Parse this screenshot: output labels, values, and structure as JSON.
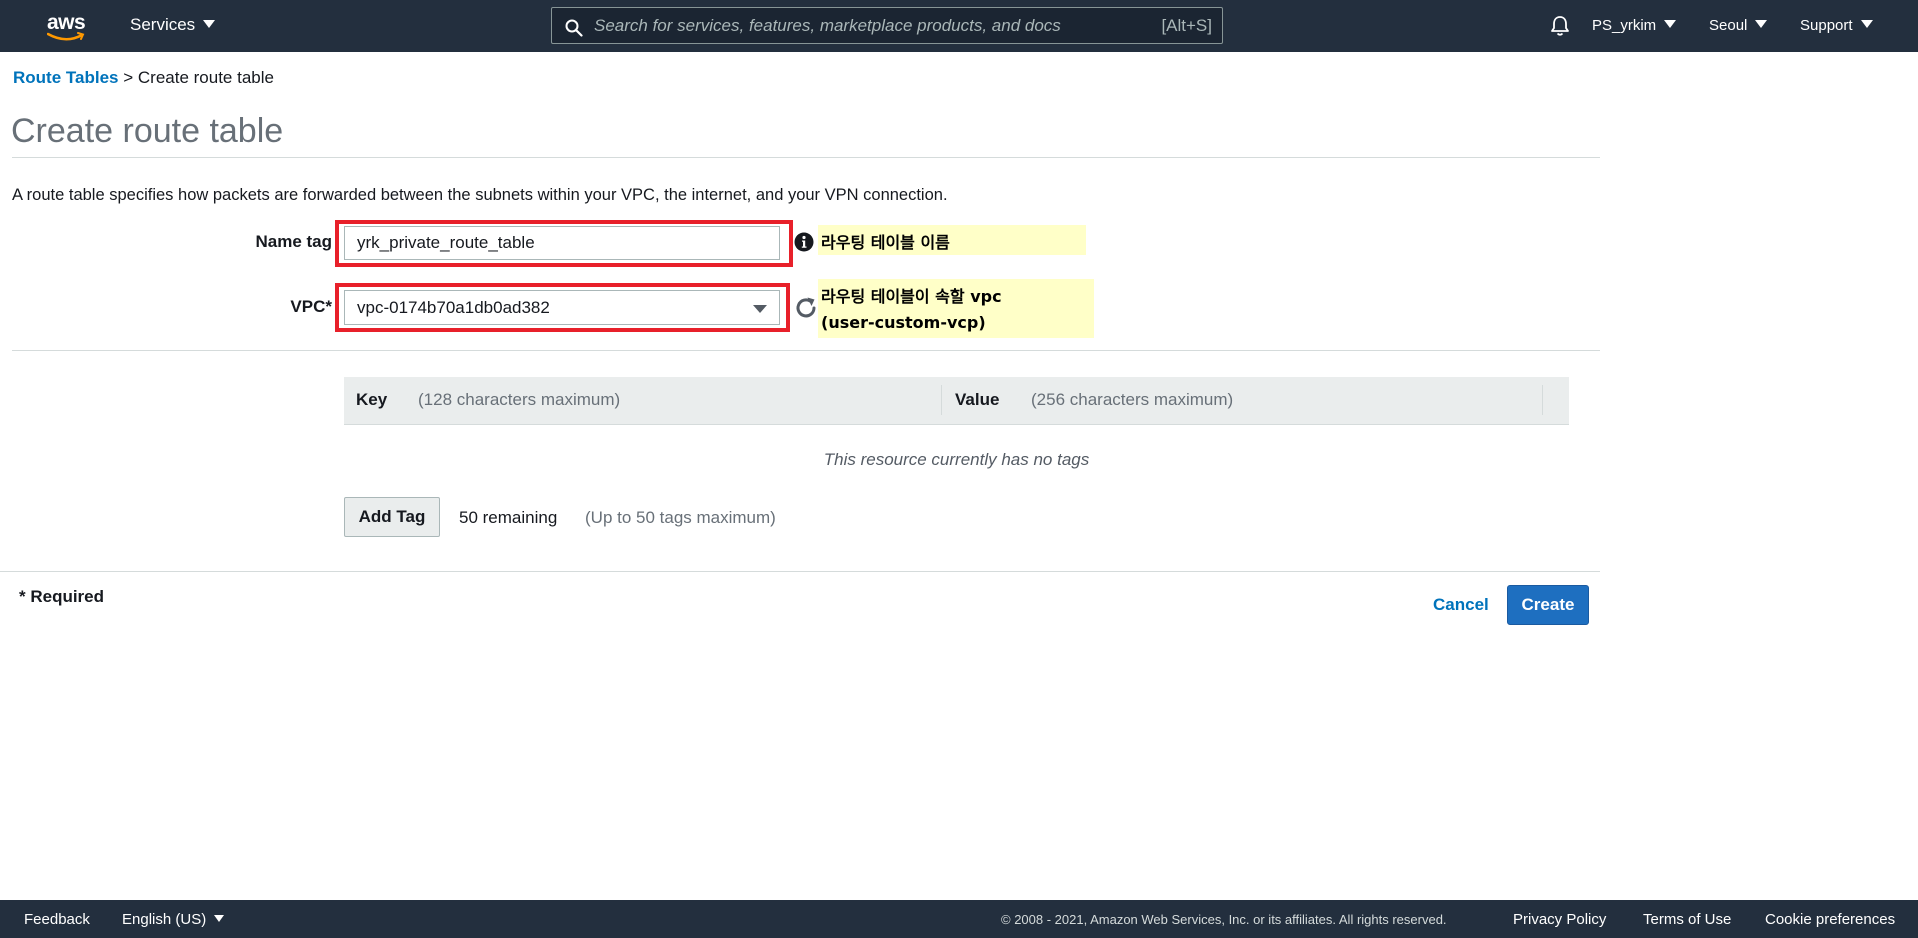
{
  "topnav": {
    "logo_text": "aws",
    "services_label": "Services",
    "search_placeholder": "Search for services, features, marketplace products, and docs",
    "search_shortcut": "[Alt+S]",
    "account": "PS_yrkim",
    "region": "Seoul",
    "support": "Support"
  },
  "breadcrumb": {
    "parent": "Route Tables",
    "separator": ">",
    "current": "Create route table"
  },
  "page": {
    "title": "Create route table",
    "description": "A route table specifies how packets are forwarded between the subnets within your VPC, the internet, and your VPN connection."
  },
  "form": {
    "name_tag_label": "Name tag",
    "name_tag_value": "yrk_private_route_table",
    "vpc_label": "VPC*",
    "vpc_value": "vpc-0174b70a1db0ad382"
  },
  "annotations": {
    "name_note": "라우팅 테이블 이름",
    "vpc_note_line1": "라우팅 테이블이 속할 vpc",
    "vpc_note_line2": "(user-custom-vcp)",
    "highlight_color": "#e8202a",
    "note_background": "#ffffc8"
  },
  "tags": {
    "key_header": "Key",
    "key_hint": "(128 characters maximum)",
    "value_header": "Value",
    "value_hint": "(256 characters maximum)",
    "empty_message": "This resource currently has no tags",
    "add_button": "Add Tag",
    "remaining": "50 remaining",
    "limit_note": "(Up to 50 tags maximum)"
  },
  "actions": {
    "required_note": "* Required",
    "cancel": "Cancel",
    "create": "Create",
    "primary_color": "#1e6fc0",
    "link_color": "#0073bb"
  },
  "footer": {
    "feedback": "Feedback",
    "language": "English (US)",
    "copyright": "© 2008 - 2021, Amazon Web Services, Inc. or its affiliates. All rights reserved.",
    "privacy": "Privacy Policy",
    "terms": "Terms of Use",
    "cookies": "Cookie preferences"
  },
  "icons": [
    "aws-logo",
    "search-icon",
    "bell-icon",
    "info-icon",
    "refresh-icon",
    "caret-down-icon"
  ]
}
